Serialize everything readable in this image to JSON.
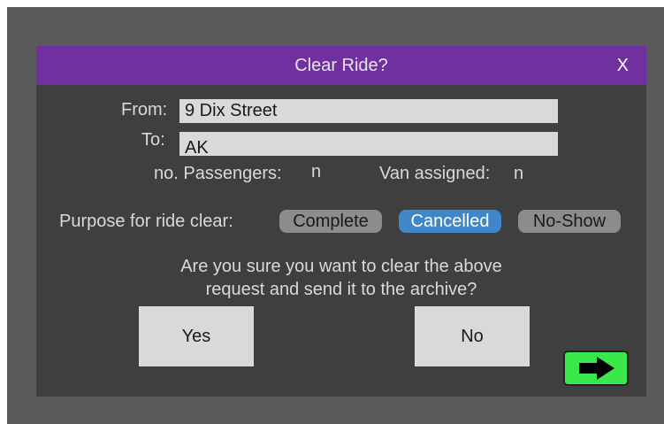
{
  "dialog": {
    "title": "Clear Ride?",
    "close_label": "X",
    "from_label": "From:",
    "from_value": "9 Dix Street",
    "to_label": "To:",
    "to_value": "AK",
    "passengers_label": "no. Passengers:",
    "passengers_value": "n",
    "van_label": "Van assigned:",
    "van_value": "n",
    "purpose_label": "Purpose for ride clear:",
    "purpose_options": [
      {
        "label": "Complete",
        "selected": false
      },
      {
        "label": "Cancelled",
        "selected": true
      },
      {
        "label": "No-Show",
        "selected": false
      }
    ],
    "question_line1": "Are you sure you want to clear the above",
    "question_line2": "request and send it to the archive?",
    "yes_label": "Yes",
    "no_label": "No",
    "next_icon": "right-arrow-icon"
  },
  "colors": {
    "titlebar": "#7030a0",
    "selected_pill": "#3f87c9",
    "next_button": "#39e84a",
    "dialog_bg": "#3f3f3f"
  }
}
